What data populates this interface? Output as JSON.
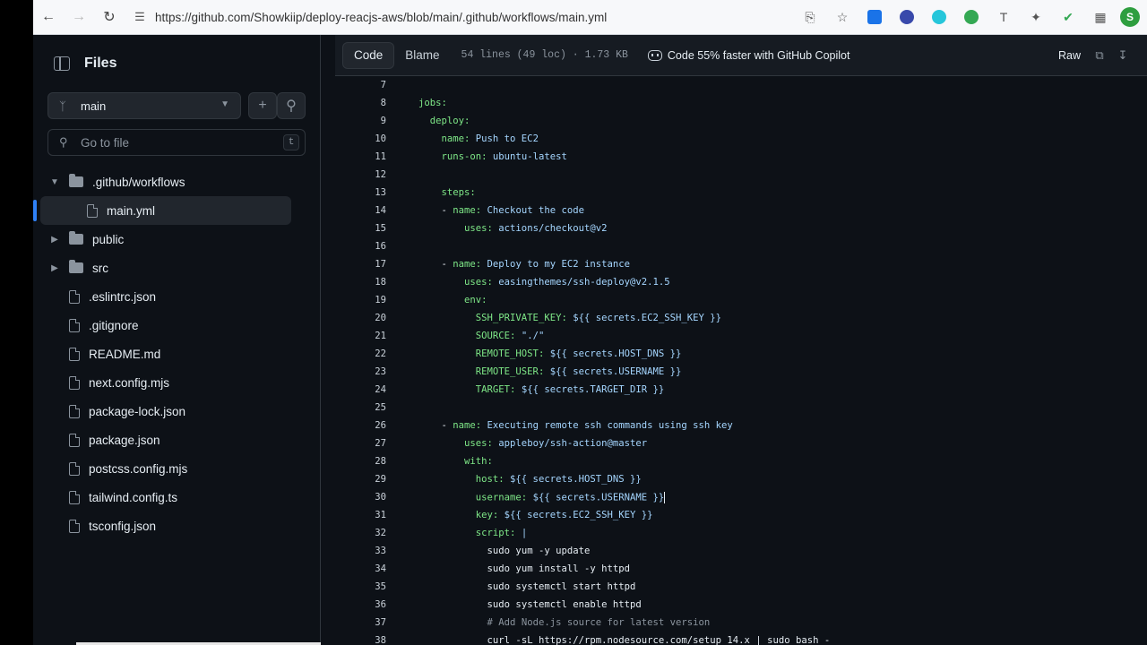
{
  "browser": {
    "url": "https://github.com/Showkiip/deploy-reacjs-aws/blob/main/.github/workflows/main.yml",
    "profile_initial": "S"
  },
  "tree": {
    "title": "Files",
    "branch": "main",
    "search_placeholder": "Go to file",
    "search_shortcut": "t",
    "items": [
      {
        "label": ".github/workflows",
        "type": "folder",
        "expanded": true,
        "depth": 0
      },
      {
        "label": "main.yml",
        "type": "file",
        "selected": true,
        "depth": 1
      },
      {
        "label": "public",
        "type": "folder",
        "expanded": false,
        "depth": 0
      },
      {
        "label": "src",
        "type": "folder",
        "expanded": false,
        "depth": 0
      },
      {
        "label": ".eslintrc.json",
        "type": "file",
        "depth": 0
      },
      {
        "label": ".gitignore",
        "type": "file",
        "depth": 0
      },
      {
        "label": "README.md",
        "type": "file",
        "depth": 0
      },
      {
        "label": "next.config.mjs",
        "type": "file",
        "depth": 0
      },
      {
        "label": "package-lock.json",
        "type": "file",
        "depth": 0
      },
      {
        "label": "package.json",
        "type": "file",
        "depth": 0
      },
      {
        "label": "postcss.config.mjs",
        "type": "file",
        "depth": 0
      },
      {
        "label": "tailwind.config.ts",
        "type": "file",
        "depth": 0
      },
      {
        "label": "tsconfig.json",
        "type": "file",
        "depth": 0
      }
    ]
  },
  "toolbar": {
    "code_label": "Code",
    "blame_label": "Blame",
    "file_meta": "54 lines (49 loc) · 1.73 KB",
    "copilot_label": "Code 55% faster with GitHub Copilot",
    "raw_label": "Raw"
  },
  "code": {
    "lines": [
      {
        "n": "7",
        "indent": 0,
        "key": "",
        "val": ""
      },
      {
        "n": "8",
        "indent": 0,
        "key": "jobs:",
        "val": ""
      },
      {
        "n": "9",
        "indent": 2,
        "key": "deploy:",
        "val": ""
      },
      {
        "n": "10",
        "indent": 4,
        "key": "name:",
        "val": " Push to EC2"
      },
      {
        "n": "11",
        "indent": 4,
        "key": "runs-on:",
        "val": " ubuntu-latest"
      },
      {
        "n": "12",
        "indent": 0,
        "key": "",
        "val": ""
      },
      {
        "n": "13",
        "indent": 4,
        "key": "steps:",
        "val": ""
      },
      {
        "n": "14",
        "indent": 6,
        "dash": true,
        "key": "name:",
        "val": " Checkout the code"
      },
      {
        "n": "15",
        "indent": 8,
        "key": "uses:",
        "val": " actions/checkout@v2"
      },
      {
        "n": "16",
        "indent": 0,
        "key": "",
        "val": ""
      },
      {
        "n": "17",
        "indent": 6,
        "dash": true,
        "key": "name:",
        "val": " Deploy to my EC2 instance"
      },
      {
        "n": "18",
        "indent": 8,
        "key": "uses:",
        "val": " easingthemes/ssh-deploy@v2.1.5"
      },
      {
        "n": "19",
        "indent": 8,
        "key": "env:",
        "val": ""
      },
      {
        "n": "20",
        "indent": 10,
        "key": "SSH_PRIVATE_KEY:",
        "val": " ${{ secrets.EC2_SSH_KEY }}"
      },
      {
        "n": "21",
        "indent": 10,
        "key": "SOURCE:",
        "val": " \"./\""
      },
      {
        "n": "22",
        "indent": 10,
        "key": "REMOTE_HOST:",
        "val": " ${{ secrets.HOST_DNS }}"
      },
      {
        "n": "23",
        "indent": 10,
        "key": "REMOTE_USER:",
        "val": " ${{ secrets.USERNAME }}"
      },
      {
        "n": "24",
        "indent": 10,
        "key": "TARGET:",
        "val": " ${{ secrets.TARGET_DIR }}"
      },
      {
        "n": "25",
        "indent": 0,
        "key": "",
        "val": ""
      },
      {
        "n": "26",
        "indent": 6,
        "dash": true,
        "key": "name:",
        "val": " Executing remote ssh commands using ssh key"
      },
      {
        "n": "27",
        "indent": 8,
        "key": "uses:",
        "val": " appleboy/ssh-action@master"
      },
      {
        "n": "28",
        "indent": 8,
        "key": "with:",
        "val": ""
      },
      {
        "n": "29",
        "indent": 10,
        "key": "host:",
        "val": " ${{ secrets.HOST_DNS }}"
      },
      {
        "n": "30",
        "indent": 10,
        "key": "username:",
        "val": " ${{ secrets.USERNAME }}",
        "caret": true
      },
      {
        "n": "31",
        "indent": 10,
        "key": "key:",
        "val": " ${{ secrets.EC2_SSH_KEY }}"
      },
      {
        "n": "32",
        "indent": 10,
        "key": "script:",
        "val": " |"
      },
      {
        "n": "33",
        "indent": 12,
        "key": "",
        "val": "sudo yum -y update"
      },
      {
        "n": "34",
        "indent": 12,
        "key": "",
        "val": "sudo yum install -y httpd"
      },
      {
        "n": "35",
        "indent": 12,
        "key": "",
        "val": "sudo systemctl start httpd"
      },
      {
        "n": "36",
        "indent": 12,
        "key": "",
        "val": "sudo systemctl enable httpd"
      },
      {
        "n": "37",
        "indent": 12,
        "key": "",
        "val": "# Add Node.js source for latest version",
        "comment": true
      },
      {
        "n": "38",
        "indent": 12,
        "key": "",
        "val": "curl -sL https://rpm.nodesource.com/setup_14.x | sudo bash -"
      }
    ]
  }
}
